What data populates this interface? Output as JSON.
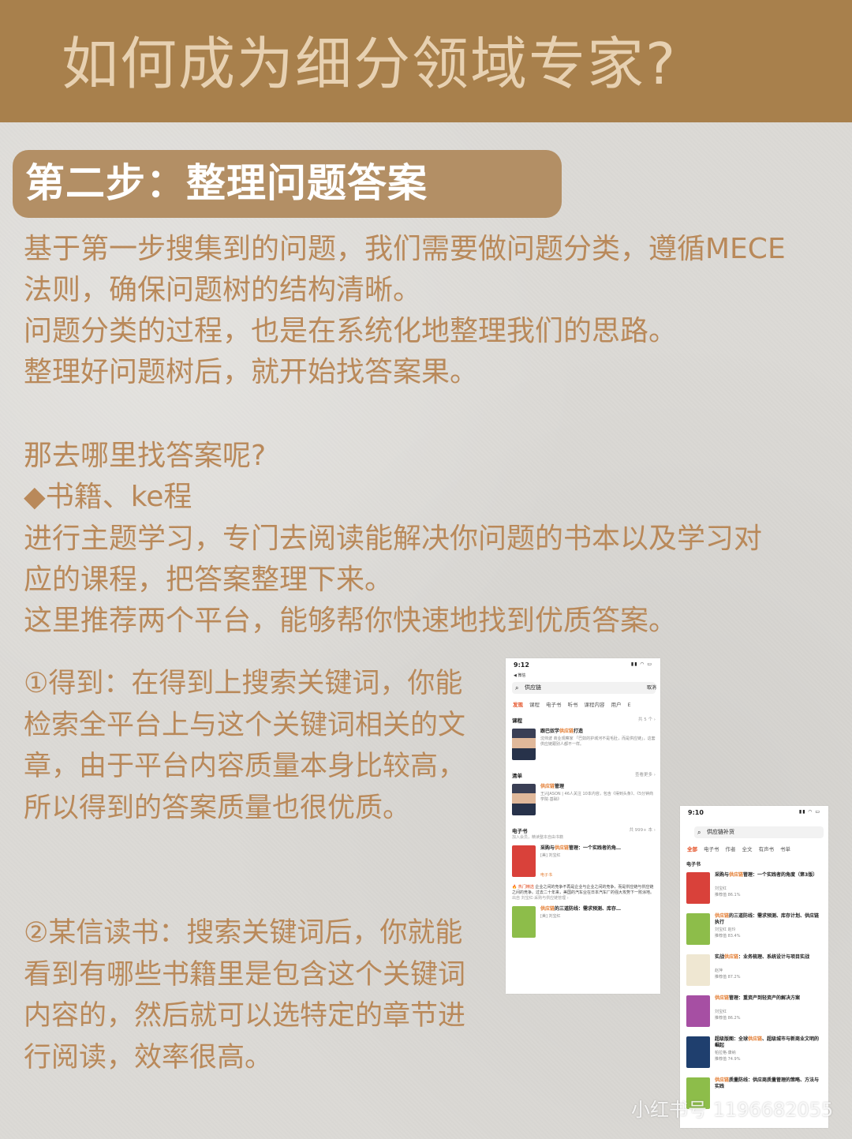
{
  "header": {
    "title": "如何成为细分领域专家?"
  },
  "step": {
    "title": "第二步：整理问题答案"
  },
  "intro": {
    "lines": [
      "基于第一步搜集到的问题，我们需要做问题分类，遵循MECE",
      "法则，确保问题树的结构清晰。",
      "问题分类的过程，也是在系统化地整理我们的思路。",
      "整理好问题树后，就开始找答案果。"
    ]
  },
  "where": {
    "question": "那去哪里找答案呢?",
    "bullet_symbol": "◆",
    "bullet_label": "书籍、ke程",
    "lines": [
      "进行主题学习，专门去阅读能解决你问题的书本以及学习对",
      "应的课程，把答案整理下来。",
      "这里推荐两个平台，能够帮你快速地找到优质答案。"
    ]
  },
  "platforms": {
    "dedao": "①得到：在得到上搜索关键词，你能检索全平台上与这个关键词相关的文章，由于平台内容质量本身比较高，所以得到的答案质量也很优质。",
    "weread": "②某信读书：搜索关键词后，你就能看到有哪些书籍里是包含这个关键词内容的，然后就可以选特定的章节进行阅读，效率很高。"
  },
  "phone1": {
    "time": "9:12",
    "back_label": "◀ 微信",
    "search_value": "供应链",
    "cancel": "取消",
    "tabs": [
      "发现",
      "课程",
      "电子书",
      "听书",
      "课程内容",
      "用户",
      "E"
    ],
    "sections": {
      "course": {
        "title": "课程",
        "more": "共 5 个 ›"
      },
      "list": {
        "title": "清单",
        "more": "查看更多 ›"
      },
      "ebook": {
        "title": "电子书",
        "subtitle": "加入会员，精读整本自由书籍",
        "more": "共 999+ 本 ›"
      }
    },
    "course_item": {
      "title_pre": "跟巴奴学",
      "title_hl": "供应链",
      "title_post": "打造",
      "desc": "沈帅波 商业观察家 「巴奴的护城河不是毛肚，而是供应链」，这套供应链跟别人都不一样。"
    },
    "list_item": {
      "title_hl": "供应链",
      "title_post": "管理",
      "desc": "王兴JASON | 46人关注 10本内容，包含《得到头条》、《5分钟商学院·基础》"
    },
    "ebook_item": {
      "title_pre": "采购与",
      "title_hl": "供应链",
      "title_post": "管理：一个实践者的角…",
      "desc": "[美] 刘宝红",
      "cover_label": "电子书"
    },
    "note": {
      "hot": "🔥 热门精选",
      "text": "企业之间的竞争不再是企业与企业之间的竞争，而是供应链与供应链之间的竞争。过去二十年来，美国的汽车业在日本汽车厂的强大攻势下一败涂地。",
      "source": "出自 刘宝红·采购与供应链管理 ›"
    },
    "last_item": {
      "title_hl": "供应链",
      "title_post": "的三道防线：需求预测、库存…",
      "desc": "[美] 刘宝红"
    }
  },
  "phone2": {
    "time": "9:10",
    "search_value": "供应链补货",
    "tabs": [
      "全部",
      "电子书",
      "作者",
      "全文",
      "有声书",
      "书单"
    ],
    "section": "电子书",
    "items": [
      {
        "hl": "供应链",
        "pre": "采购与",
        "post": "管理：一个实践者的角度（第3版）",
        "author": "刘宝红",
        "rate": "推荐值 86.1%"
      },
      {
        "hl": "供应链",
        "pre": "",
        "post": "的三道防线：需求预测、库存计划、供应链执行",
        "author": "刘宝红 赵玲",
        "rate": "推荐值 83.4%"
      },
      {
        "hl": "供应链",
        "pre": "实战",
        "post": "：业务梳理、系统设计与项目实战",
        "author": "赵萍",
        "rate": "推荐值 87.2%"
      },
      {
        "hl": "供应链",
        "pre": "",
        "post": "管理：重资产到轻资产的解决方案",
        "author": "刘宝红",
        "rate": "推荐值 86.2%"
      },
      {
        "hl": "供应链",
        "pre": "超级版图：全球",
        "post": "、超级城市与新商业文明的崛起",
        "author": "帕拉格·康纳",
        "rate": "推荐值 74.9%"
      },
      {
        "hl": "供应链",
        "pre": "",
        "post": "质量防线：供应商质量管理的策略、方法与实践",
        "author": "",
        "rate": ""
      }
    ]
  },
  "watermark": "小红书号 1196682055",
  "colors": {
    "header_bg": "#a8804c",
    "header_text": "#e7d1b2",
    "pill_bg": "#b38f65",
    "body_text": "#b9895a",
    "page_bg": "#dcdad6"
  }
}
